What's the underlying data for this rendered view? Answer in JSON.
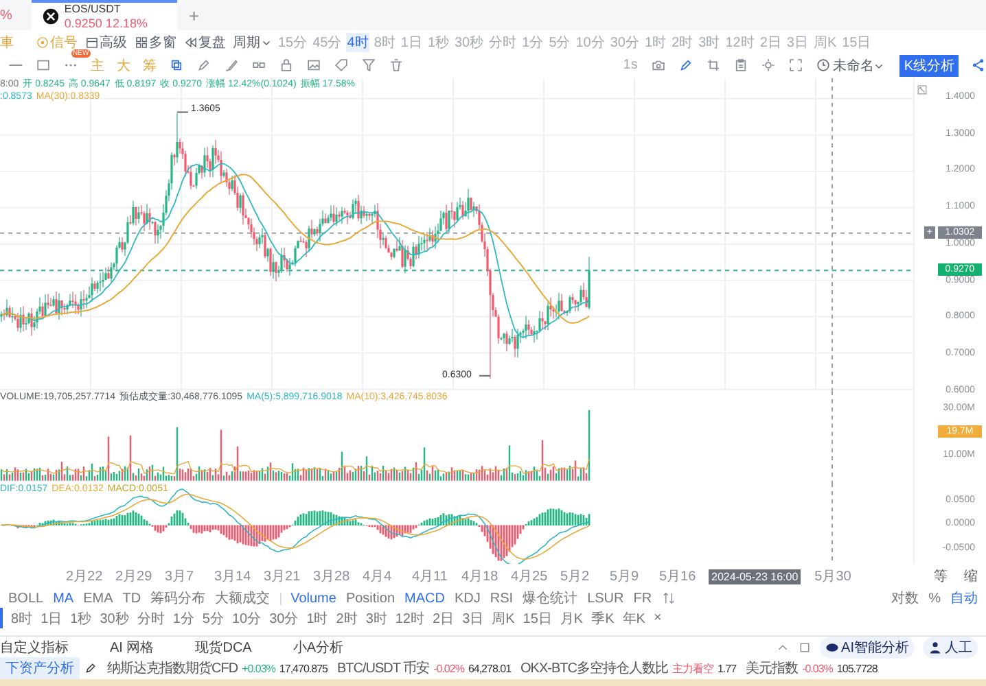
{
  "tab_bar": {
    "cut_text": "%",
    "tab": {
      "symbol": "EOS/USDT",
      "price": "0.9250",
      "change": "12.18%",
      "selected": true
    },
    "add_label": "+"
  },
  "toolbar": {
    "cut_text": "車",
    "tools": [
      {
        "label": "信号",
        "kind": "signal"
      },
      {
        "label": "高级",
        "kind": "advanced"
      },
      {
        "label": "多窗",
        "kind": "multi"
      },
      {
        "label": "复盘",
        "kind": "replay"
      }
    ],
    "period_label": "周期",
    "intervals": [
      {
        "label": "15分",
        "selected": false
      },
      {
        "label": "45分",
        "selected": false
      },
      {
        "label": "4时",
        "selected": true
      },
      {
        "label": "8时",
        "selected": false
      },
      {
        "label": "1日",
        "selected": false
      },
      {
        "label": "1秒",
        "selected": false
      },
      {
        "label": "30秒",
        "selected": false
      },
      {
        "label": "分时",
        "selected": false
      },
      {
        "label": "1分",
        "selected": false
      },
      {
        "label": "5分",
        "selected": false
      },
      {
        "label": "10分",
        "selected": false
      },
      {
        "label": "30分",
        "selected": false
      },
      {
        "label": "1时",
        "selected": false
      },
      {
        "label": "2时",
        "selected": false
      },
      {
        "label": "3时",
        "selected": false
      },
      {
        "label": "12时",
        "selected": false
      },
      {
        "label": "2日",
        "selected": false
      },
      {
        "label": "3日",
        "selected": false
      },
      {
        "label": "周K",
        "selected": false
      },
      {
        "label": "15日",
        "selected": false
      }
    ],
    "speed": "1s",
    "layout_name": "未命名",
    "analysis_button": "K线分析"
  },
  "drawing_bar": {
    "new_badge": "NEW",
    "indicator_tools": [
      "主",
      "大",
      "筹"
    ]
  },
  "chart": {
    "time_fragment": "8:00",
    "ohlc": [
      {
        "label": "开",
        "value": "0.8245"
      },
      {
        "label": "高",
        "value": "0.9647"
      },
      {
        "label": "低",
        "value": "0.8197"
      },
      {
        "label": "收",
        "value": "0.9270"
      },
      {
        "label": "涨幅",
        "value": "12.42%(0.1024)"
      },
      {
        "label": "振幅",
        "value": "17.58%"
      }
    ],
    "ma_values": [
      {
        "text": ":0.8573",
        "color": "#2fb7c4"
      },
      {
        "text": "MA(30):0.8339",
        "color": "#e8a83a"
      }
    ],
    "price_ticks": [
      "1.4000",
      "1.3000",
      "1.2000",
      "1.1000",
      "1.0000",
      "0.9000",
      "0.8000",
      "0.7000",
      "0.6000"
    ],
    "add_alert_label": "+",
    "high_label": "1.3605",
    "low_label": "0.6300",
    "crosshair_label": "1.0302",
    "last_price": "0.9270"
  },
  "volume": {
    "items": [
      {
        "text": "VOLUME:19,705,257.7714",
        "color": "#555b66"
      },
      {
        "text": "预估成交量:30,468,776.1095",
        "color": "#555b66"
      },
      {
        "text": "MA(5):5,899,716.9018",
        "color": "#2fb7c4"
      },
      {
        "text": "MA(10):3,426,745.8036",
        "color": "#e8a83a"
      }
    ],
    "ticks": [
      "30.00M",
      "10.00M"
    ],
    "last_label": "19.7M"
  },
  "macd": {
    "items": [
      {
        "text": "DIF:0.0157",
        "color": "#2fb7c4"
      },
      {
        "text": "DEA:0.0132",
        "color": "#e8a83a"
      },
      {
        "text": "MACD:0.0051",
        "color": "#c9a227"
      }
    ],
    "ticks": [
      "0.0500",
      "0.0000",
      "-0.0500"
    ]
  },
  "date_axis": {
    "dates_before": [
      "2月22",
      "2月29",
      "3月7",
      "3月14",
      "3月21",
      "3月28",
      "4月4",
      "4月11",
      "4月18",
      "4月25",
      "5月2",
      "5月9",
      "5月16"
    ],
    "crosshair_date": "2024-05-23 16:00",
    "dates_after": [
      "5月30"
    ],
    "corner_labels": [
      "等",
      "缩"
    ]
  },
  "indicator_bar": {
    "main": [
      {
        "label": "BOLL",
        "selected": false
      },
      {
        "label": "MA",
        "selected": true
      },
      {
        "label": "EMA",
        "selected": false
      },
      {
        "label": "TD",
        "selected": false
      },
      {
        "label": "筹码分布",
        "selected": false
      },
      {
        "label": "大额成交",
        "selected": false
      }
    ],
    "sub": [
      {
        "label": "Volume",
        "selected": true
      },
      {
        "label": "Position",
        "selected": false
      },
      {
        "label": "MACD",
        "selected": true
      },
      {
        "label": "KDJ",
        "selected": false
      },
      {
        "label": "RSI",
        "selected": false
      },
      {
        "label": "爆仓统计",
        "selected": false
      },
      {
        "label": "LSUR",
        "selected": false
      },
      {
        "label": "FR",
        "selected": false
      }
    ],
    "scale_options": [
      {
        "label": "对数",
        "selected": false
      },
      {
        "label": "%",
        "selected": false
      },
      {
        "label": "自动",
        "selected": true
      }
    ]
  },
  "interval_bar": {
    "items": [
      {
        "label": "8时",
        "selected": false
      },
      {
        "label": "1日",
        "selected": false
      },
      {
        "label": "1秒",
        "selected": false
      },
      {
        "label": "30秒",
        "selected": false
      },
      {
        "label": "分时",
        "selected": false
      },
      {
        "label": "1分",
        "selected": false
      },
      {
        "label": "5分",
        "selected": false
      },
      {
        "label": "10分",
        "selected": false
      },
      {
        "label": "30分",
        "selected": false
      },
      {
        "label": "1时",
        "selected": false
      },
      {
        "label": "2时",
        "selected": false
      },
      {
        "label": "3时",
        "selected": false
      },
      {
        "label": "12时",
        "selected": false
      },
      {
        "label": "2日",
        "selected": false
      },
      {
        "label": "3日",
        "selected": false
      },
      {
        "label": "周K",
        "selected": false
      },
      {
        "label": "15日",
        "selected": false
      },
      {
        "label": "月K",
        "selected": false
      },
      {
        "label": "季K",
        "selected": false
      },
      {
        "label": "年K",
        "selected": false
      }
    ],
    "close_label": "×"
  },
  "bottom_tabs": [
    {
      "label": "自定义指标",
      "selected": false
    },
    {
      "label": "AI 网格",
      "selected": false
    },
    {
      "label": "现货DCA",
      "selected": false
    },
    {
      "label": "小A分析",
      "selected": false
    }
  ],
  "ticker": {
    "left_button": "下资产分析",
    "items": [
      {
        "name": "纳斯达克指数期货CFD",
        "change": "+0.03%",
        "color": "#26b584",
        "value": "17,470.875"
      },
      {
        "name": "BTC/USDT 币安",
        "change": "-0.02%",
        "color": "#ef5a6f",
        "value": "64,278.01"
      },
      {
        "name": "OKX-BTC多空持仓人数比",
        "change": "主力看空",
        "color": "#ef5a6f",
        "value": "1.77"
      },
      {
        "name": "美元指数",
        "change": "-0.03%",
        "color": "#ef5a6f",
        "value": "105.7728"
      }
    ],
    "ai_button": "AI智能分析",
    "service_button": "人工"
  }
}
